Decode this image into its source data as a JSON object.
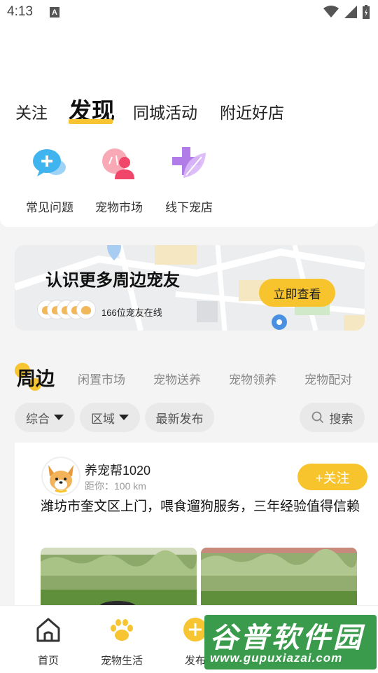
{
  "status_bar": {
    "time": "4:13",
    "notification_icon": "A"
  },
  "top_tabs": [
    {
      "label": "关注",
      "active": false
    },
    {
      "label": "发现",
      "active": true
    },
    {
      "label": "同城活动",
      "active": false
    },
    {
      "label": "附近好店",
      "active": false
    }
  ],
  "quick_actions": [
    {
      "label": "常见问题",
      "icon": "chat-bubble-plus-icon"
    },
    {
      "label": "宠物市场",
      "icon": "user-group-icon"
    },
    {
      "label": "线下宠店",
      "icon": "plus-leaf-icon"
    }
  ],
  "banner": {
    "title": "认识更多周边宠友",
    "online_text": "166位宠友在线",
    "cta_label": "立即查看"
  },
  "category_tabs": [
    {
      "label": "周边",
      "active": true
    },
    {
      "label": "闲置市场",
      "active": false
    },
    {
      "label": "宠物送养",
      "active": false
    },
    {
      "label": "宠物领养",
      "active": false
    },
    {
      "label": "宠物配对",
      "active": false
    }
  ],
  "filters": {
    "sort": "综合",
    "region": "区域",
    "latest": "最新发布",
    "search_placeholder": "搜索"
  },
  "post": {
    "username": "养宠帮1020",
    "distance": "距你：100 km",
    "follow_label": "+关注",
    "content": "潍坊市奎文区上门，喂食遛狗服务，三年经验值得信赖"
  },
  "bottom_nav": [
    {
      "label": "首页",
      "icon": "home-icon"
    },
    {
      "label": "宠物生活",
      "icon": "paw-icon"
    },
    {
      "label": "发布",
      "icon": "plus-circle-icon"
    }
  ],
  "watermark": {
    "title": "谷普软件园",
    "url": "www.gupuxiazai.com"
  },
  "colors": {
    "accent": "#f6c531",
    "follow_button": "#f7c42e",
    "watermark_green": "#3a9b4c"
  }
}
